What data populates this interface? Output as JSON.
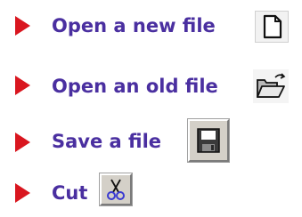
{
  "items": [
    {
      "label": "Open a new file",
      "icon": "new-file-icon"
    },
    {
      "label": "Open an old file",
      "icon": "open-folder-icon"
    },
    {
      "label": "Save a file",
      "icon": "floppy-disk-icon"
    },
    {
      "label": "Cut",
      "icon": "scissors-icon"
    }
  ],
  "colors": {
    "bullet": "#d9161f",
    "text": "#4a2fa0"
  }
}
